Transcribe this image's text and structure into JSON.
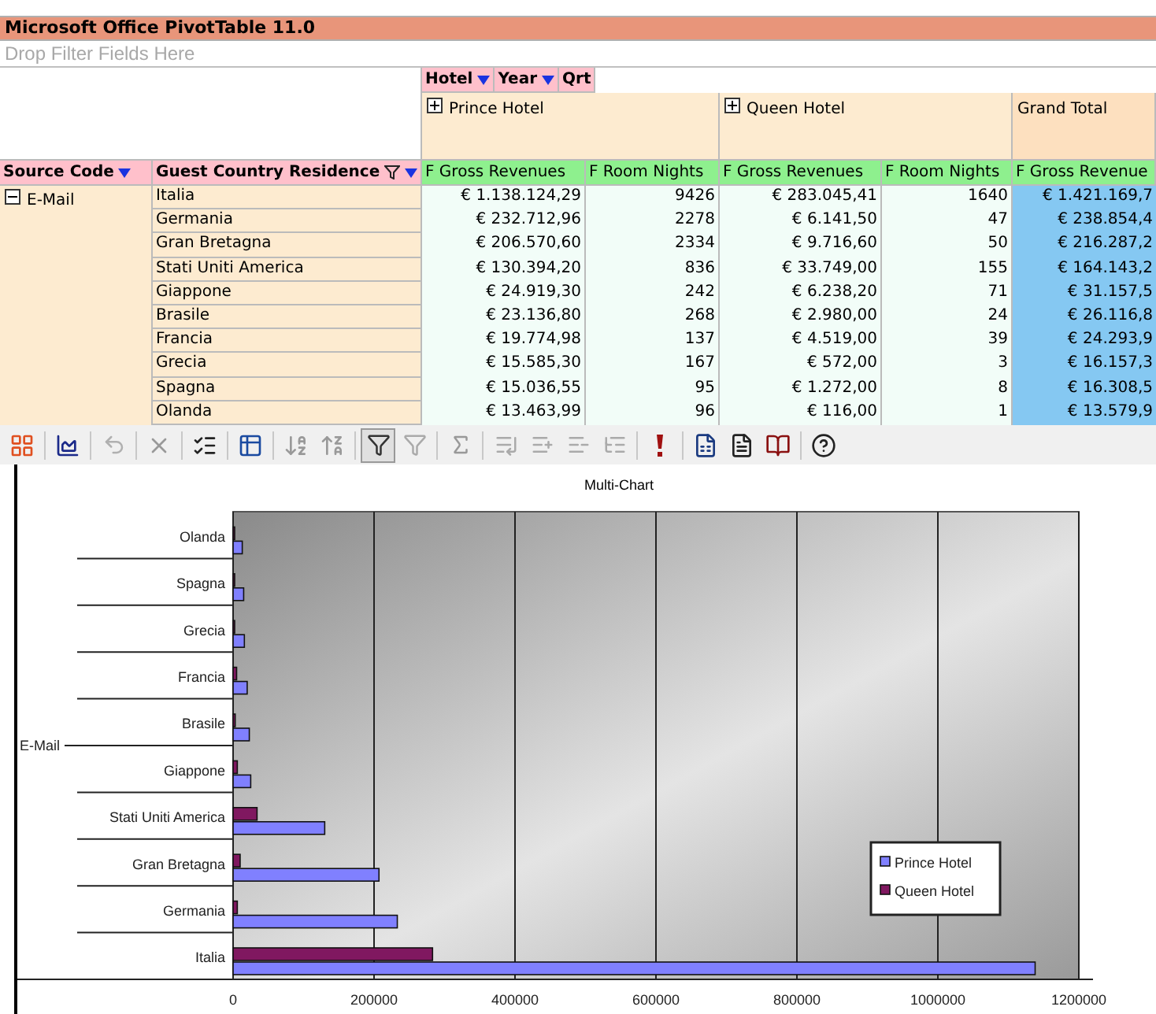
{
  "title": "Microsoft Office PivotTable 11.0",
  "filter_drop_zone": "Drop Filter Fields Here",
  "column_fields": [
    {
      "label": "Hotel",
      "dropdown": true
    },
    {
      "label": "Year",
      "dropdown": true
    },
    {
      "label": "Qrt",
      "dropdown": false
    }
  ],
  "column_groups": [
    {
      "label": "Prince Hotel",
      "expandable": true
    },
    {
      "label": "Queen Hotel",
      "expandable": true
    },
    {
      "label": "Grand Total",
      "expandable": false
    }
  ],
  "row_fields": [
    {
      "label": "Source Code",
      "filtered": false
    },
    {
      "label": "Guest Country Residence",
      "filtered": true
    }
  ],
  "measures": [
    "F Gross Revenues",
    "F Room Nights",
    "F Gross Revenues",
    "F Room Nights",
    "F Gross Revenue"
  ],
  "row_group": {
    "label": "E-Mail",
    "expanded": true
  },
  "rows": [
    {
      "country": "Italia",
      "cells": [
        "€ 1.138.124,29",
        "9426",
        "€ 283.045,41",
        "1640",
        "€ 1.421.169,7"
      ]
    },
    {
      "country": "Germania",
      "cells": [
        "€ 232.712,96",
        "2278",
        "€ 6.141,50",
        "47",
        "€ 238.854,4"
      ]
    },
    {
      "country": "Gran Bretagna",
      "cells": [
        "€ 206.570,60",
        "2334",
        "€ 9.716,60",
        "50",
        "€ 216.287,2"
      ]
    },
    {
      "country": "Stati Uniti America",
      "cells": [
        "€ 130.394,20",
        "836",
        "€ 33.749,00",
        "155",
        "€ 164.143,2"
      ]
    },
    {
      "country": "Giappone",
      "cells": [
        "€ 24.919,30",
        "242",
        "€ 6.238,20",
        "71",
        "€ 31.157,5"
      ]
    },
    {
      "country": "Brasile",
      "cells": [
        "€ 23.136,80",
        "268",
        "€ 2.980,00",
        "24",
        "€ 26.116,8"
      ]
    },
    {
      "country": "Francia",
      "cells": [
        "€ 19.774,98",
        "137",
        "€ 4.519,00",
        "39",
        "€ 24.293,9"
      ]
    },
    {
      "country": "Grecia",
      "cells": [
        "€ 15.585,30",
        "167",
        "€ 572,00",
        "3",
        "€ 16.157,3"
      ]
    },
    {
      "country": "Spagna",
      "cells": [
        "€ 15.036,55",
        "95",
        "€ 1.272,00",
        "8",
        "€ 16.308,5"
      ]
    },
    {
      "country": "Olanda",
      "cells": [
        "€ 13.463,99",
        "96",
        "€ 116,00",
        "1",
        "€ 13.579,9"
      ]
    }
  ],
  "chart": {
    "title": "Multi-Chart",
    "group_label": "E-Mail",
    "chart_data": {
      "type": "bar",
      "orientation": "horizontal",
      "categories": [
        "Olanda",
        "Spagna",
        "Grecia",
        "Francia",
        "Brasile",
        "Giappone",
        "Stati Uniti America",
        "Gran Bretagna",
        "Germania",
        "Italia"
      ],
      "series": [
        {
          "name": "Prince Hotel",
          "color": "#8080ff",
          "values": [
            13000,
            15000,
            16000,
            20000,
            23000,
            25000,
            130000,
            207000,
            233000,
            1138000
          ]
        },
        {
          "name": "Queen Hotel",
          "color": "#801860",
          "values": [
            0,
            1000,
            1000,
            5000,
            3000,
            6000,
            34000,
            10000,
            6000,
            283000
          ]
        }
      ],
      "grid": true,
      "legend": true,
      "xlim": [
        0,
        1200000
      ],
      "xticks": [
        0,
        200000,
        400000,
        600000,
        800000,
        1000000,
        1200000
      ]
    }
  }
}
